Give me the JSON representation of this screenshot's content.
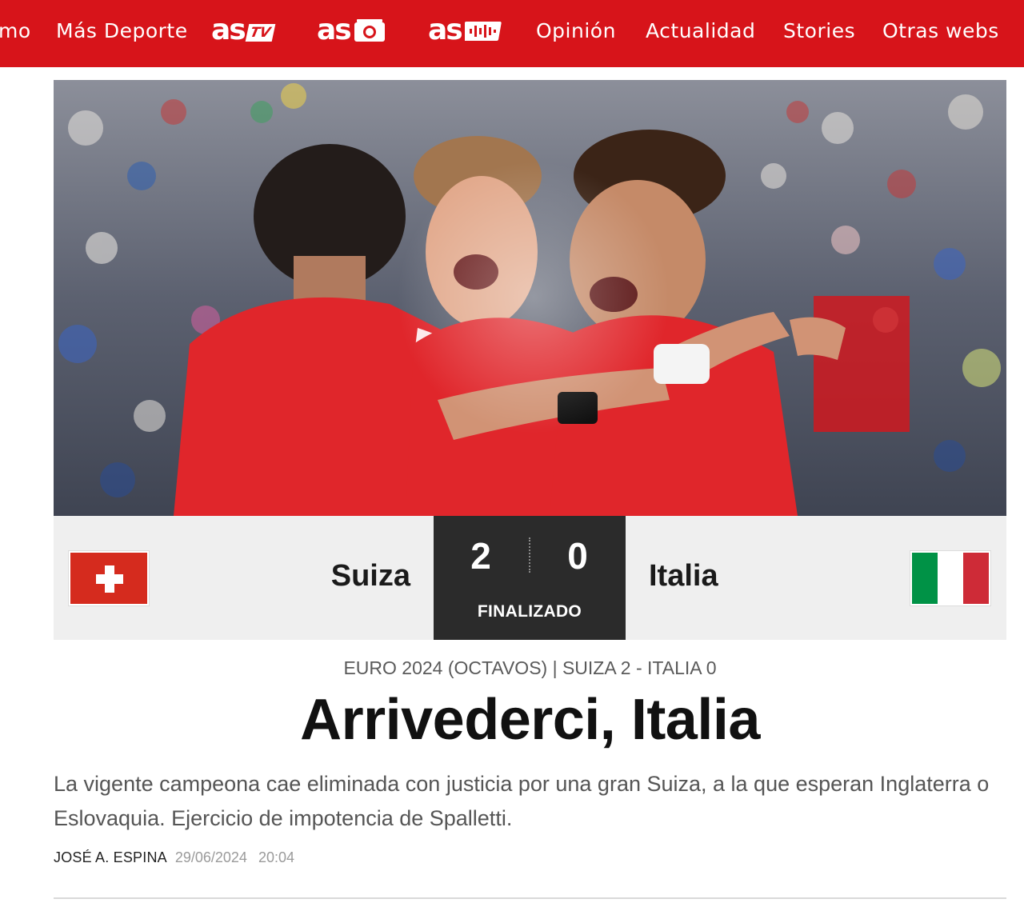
{
  "nav": {
    "items": [
      {
        "label": "mo"
      },
      {
        "label": "Más Deporte"
      },
      {
        "label": "Opinión"
      },
      {
        "label": "Actualidad"
      },
      {
        "label": "Stories"
      },
      {
        "label": "Otras webs"
      }
    ],
    "logos": [
      {
        "brand": "as",
        "suffix": "TV",
        "icon": "tv-icon"
      },
      {
        "brand": "as",
        "suffix": "",
        "icon": "camera-icon"
      },
      {
        "brand": "as",
        "suffix": "",
        "icon": "audio-bars-icon"
      }
    ],
    "background_color": "#d7141a"
  },
  "hero": {
    "description_icon": "hero-photo-image",
    "jersey_color": "#e0262b"
  },
  "match": {
    "home": {
      "name": "Suiza",
      "score": "2",
      "flag_icon": "switzerland-flag-icon"
    },
    "away": {
      "name": "Italia",
      "score": "0",
      "flag_icon": "italy-flag-icon"
    },
    "status": "FINALIZADO",
    "colors": {
      "scorebox": "#2b2b2b",
      "board": "#efefef",
      "swiss_red": "#d52b1e",
      "italy_green": "#009246",
      "italy_white": "#ffffff",
      "italy_red": "#ce2b37"
    }
  },
  "article": {
    "kicker": "EURO 2024 (OCTAVOS) | SUIZA 2 - ITALIA 0",
    "headline": "Arrivederci, Italia",
    "subtitle": "La vigente campeona cae eliminada con justicia por una gran Suiza, a la que esperan Inglaterra o Eslovaquia. Ejercicio de impotencia de Spalletti.",
    "author": "JOSÉ A. ESPINA",
    "date": "29/06/2024",
    "time": "20:04"
  }
}
